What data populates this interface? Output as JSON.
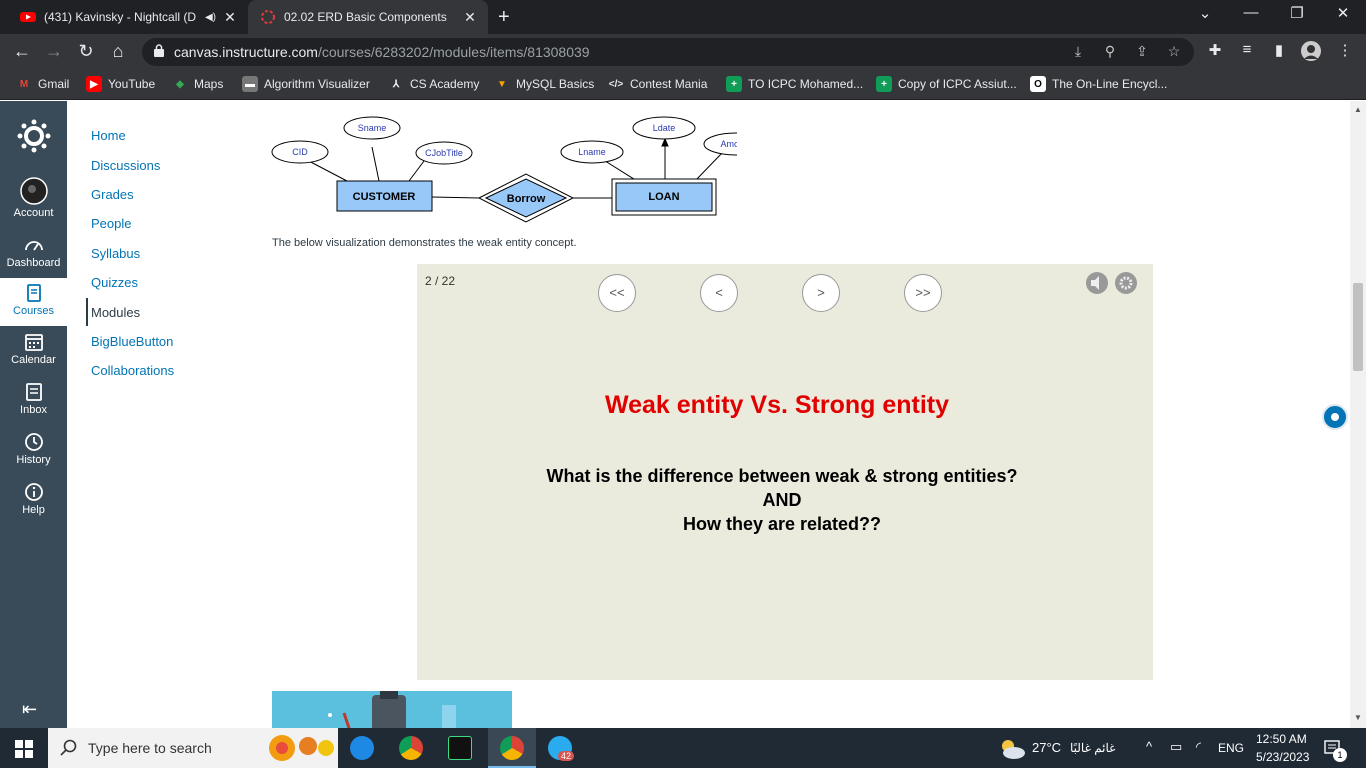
{
  "browser": {
    "tabs": [
      {
        "title": "(431) Kavinsky - Nightcall (D",
        "close": "✕"
      },
      {
        "title": "02.02 ERD Basic Components",
        "close": "✕"
      }
    ],
    "new_tab": "+",
    "url_host": "canvas.instructure.com",
    "url_path": "/courses/6283202/modules/items/81308039",
    "bookmarks": [
      "Gmail",
      "YouTube",
      "Maps",
      "Algorithm Visualizer",
      "CS Academy",
      "MySQL Basics",
      "Contest Mania",
      "TO ICPC Mohamed...",
      "Copy of ICPC Assiut...",
      "The On-Line Encycl..."
    ]
  },
  "global_nav": {
    "items": [
      "Account",
      "Dashboard",
      "Courses",
      "Calendar",
      "Inbox",
      "History",
      "Help"
    ],
    "active": "Courses"
  },
  "course_nav": {
    "items": [
      "Home",
      "Discussions",
      "Grades",
      "People",
      "Syllabus",
      "Quizzes",
      "Modules",
      "BigBlueButton",
      "Collaborations"
    ],
    "active": "Modules"
  },
  "erd": {
    "entities": [
      "CUSTOMER",
      "LOAN"
    ],
    "relationship": "Borrow",
    "attributes": [
      "Sname",
      "CID",
      "CJobTitle",
      "Ldate",
      "Lname",
      "Amount"
    ]
  },
  "content": {
    "caption": "The below visualization demonstrates the weak entity concept."
  },
  "slideshow": {
    "counter": "2 / 22",
    "buttons": [
      "<<",
      "<",
      ">",
      ">>"
    ],
    "title": "Weak entity Vs. Strong entity",
    "lines": [
      "What is the difference between weak & strong entities?",
      "AND",
      "How they are related??"
    ]
  },
  "taskbar": {
    "search_placeholder": "Type here to search",
    "weather": "27°C",
    "weather_desc": "غائم غالبًا",
    "lang": "ENG",
    "time": "12:50 AM",
    "date": "5/23/2023",
    "telegram_badge": "42",
    "notif_count": "1"
  }
}
